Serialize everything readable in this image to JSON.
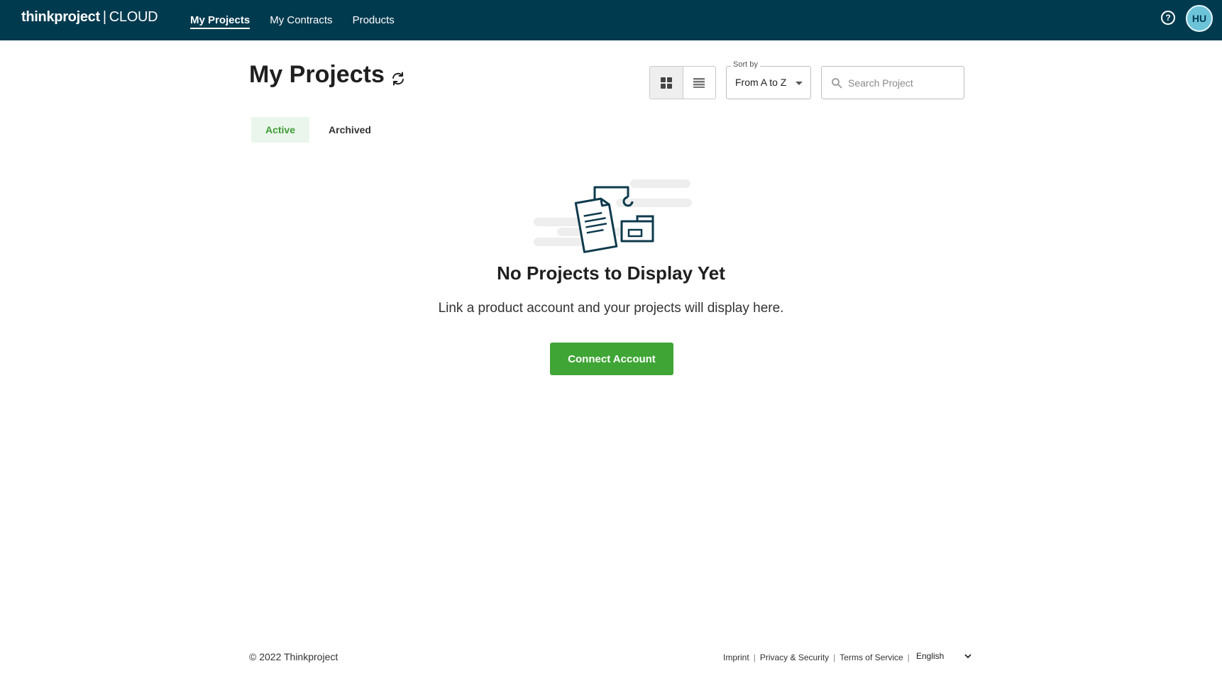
{
  "brand": {
    "name": "thinkproject",
    "separator": "|",
    "suffix": "CLOUD"
  },
  "nav": {
    "items": [
      {
        "label": "My Projects",
        "active": true
      },
      {
        "label": "My Contracts",
        "active": false
      },
      {
        "label": "Products",
        "active": false
      }
    ]
  },
  "header": {
    "help_icon": "question-circle-icon",
    "avatar_initials": "HU"
  },
  "page": {
    "title": "My Projects",
    "refresh_icon": "refresh-icon"
  },
  "view_toggle": {
    "options": [
      "grid-view-icon",
      "list-view-icon"
    ],
    "selected": "grid-view-icon"
  },
  "sort": {
    "label": "Sort by",
    "value": "From A to Z"
  },
  "search": {
    "placeholder": "Search Project",
    "value": ""
  },
  "tabs": [
    {
      "label": "Active",
      "active": true
    },
    {
      "label": "Archived",
      "active": false
    }
  ],
  "empty_state": {
    "illustration": "documents-folder-illustration",
    "title": "No Projects to Display Yet",
    "text": "Link a product account and your projects will display here.",
    "button_label": "Connect Account"
  },
  "footer": {
    "copyright": "© 2022 Thinkproject",
    "links": [
      "Imprint",
      "Privacy & Security",
      "Terms of Service"
    ],
    "language": "English"
  },
  "colors": {
    "topbar": "#003a4f",
    "accent_green": "#3fa535",
    "active_tab_bg": "#eaf6ec",
    "avatar": "#6cc3d8"
  }
}
